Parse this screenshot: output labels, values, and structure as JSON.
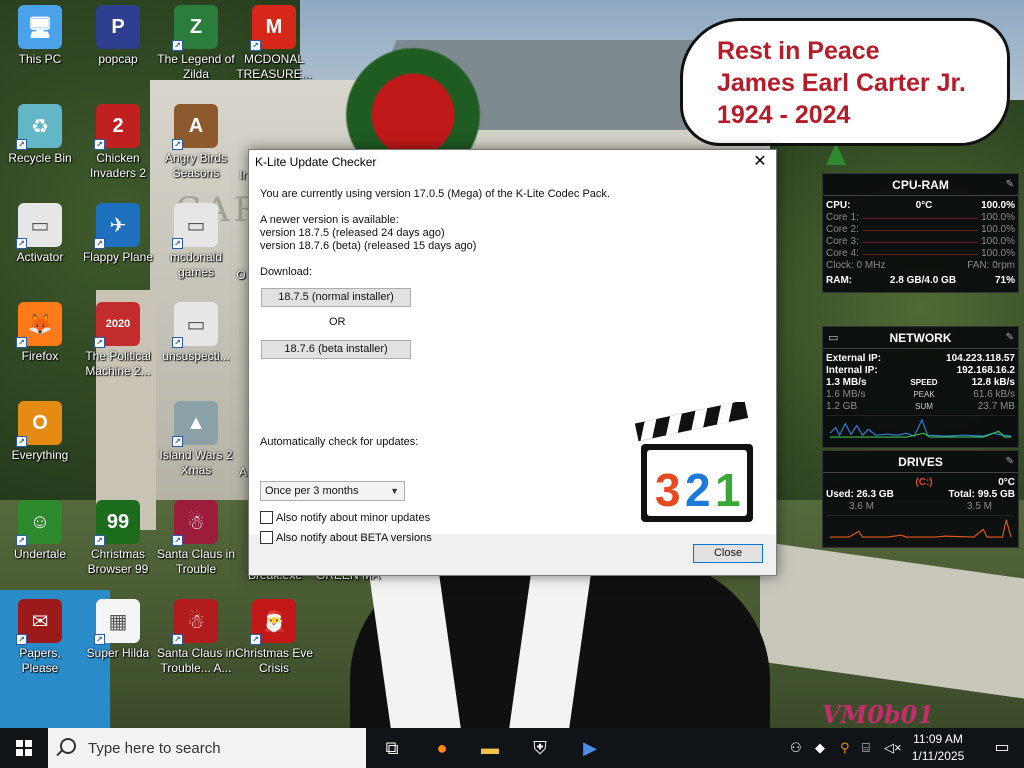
{
  "bubble": {
    "line1": "Rest in Peace",
    "line2": "James Earl Carter Jr.",
    "line3": "1924 - 2024"
  },
  "wallpaper": {
    "carved_text": "CAR",
    "watermark": "VM0b01"
  },
  "desktop_icons": [
    {
      "label": "This PC",
      "color": "#4aa3ea",
      "glyph": "🖥"
    },
    {
      "label": "popcap",
      "color": "#2e3f8f",
      "glyph": "P"
    },
    {
      "label": "The Legend of Zilda",
      "color": "#2a7d3a",
      "glyph": "Z"
    },
    {
      "label": "MCDONAL TREASURE...",
      "color": "#d62718",
      "glyph": "M"
    },
    {
      "label": "Recycle Bin",
      "color": "#63b6c5",
      "glyph": "♻"
    },
    {
      "label": "Chicken Invaders 2",
      "color": "#c02020",
      "glyph": "2"
    },
    {
      "label": "Angry Birds Seasons",
      "color": "#8c5a2c",
      "glyph": "A"
    },
    {
      "label": "Activator",
      "color": "#e6e6e6",
      "glyph": "▭"
    },
    {
      "label": "Flappy Plane",
      "color": "#1f6fbf",
      "glyph": "✈"
    },
    {
      "label": "mcdonald games",
      "color": "#e6e6e6",
      "glyph": "▭"
    },
    {
      "label": "Firefox",
      "color": "#ff7a18",
      "glyph": "🦊"
    },
    {
      "label": "The Political Machine 2...",
      "color": "#c22c2c",
      "glyph": "2020"
    },
    {
      "label": "unsuspecti...",
      "color": "#e6e6e6",
      "glyph": "▭"
    },
    {
      "label": "Everything",
      "color": "#e58a12",
      "glyph": "O"
    },
    {
      "label": "Island Wars 2 Xmas",
      "color": "#8aa1a8",
      "glyph": "▲"
    },
    {
      "label": "Undertale",
      "color": "#2d8a2d",
      "glyph": "☺"
    },
    {
      "label": "Christmas Browser 99",
      "color": "#1d6b1d",
      "glyph": "99"
    },
    {
      "label": "Santa Claus in Trouble",
      "color": "#9c1c3c",
      "glyph": "☃"
    },
    {
      "label": "Papers, Please",
      "color": "#9d1a1a",
      "glyph": "✉"
    },
    {
      "label": "Super Hilda",
      "color": "#f5f5f5",
      "glyph": "▦"
    },
    {
      "label": "Santa Claus in Trouble... A...",
      "color": "#b21c1c",
      "glyph": "☃"
    },
    {
      "label": "Christmas Eve Crisis",
      "color": "#c21818",
      "glyph": "🎅"
    }
  ],
  "partial_labels": {
    "break_exe": "Break.exe",
    "green_ma": "GREEN MA",
    "o_label": "O",
    "i_label": "Ir",
    "a_label": "A"
  },
  "dialog": {
    "title": "K-Lite Update Checker",
    "close_glyph": "✕",
    "current_version": "You are currently using version 17.0.5 (Mega) of the K-Lite Codec Pack.",
    "newer_available": "A newer version is available:",
    "version_normal": "version 18.7.5  (released 24 days ago)",
    "version_beta": "version 18.7.6  (beta)  (released 15 days ago)",
    "download_label": "Download:",
    "btn_normal": "18.7.5 (normal installer)",
    "or_text": "OR",
    "btn_beta": "18.7.6 (beta installer)",
    "auto_check_label": "Automatically check for updates:",
    "frequency": "Once per 3 months",
    "notify_minor": "Also notify about minor updates",
    "notify_beta": "Also notify about BETA versions",
    "notify_minor_checked": false,
    "notify_beta_checked": false,
    "close_button": "Close",
    "logo_digits": [
      "3",
      "2",
      "1"
    ],
    "logo_colors": [
      "#e8491e",
      "#1e7ad6",
      "#3aa836"
    ]
  },
  "cpu_gadget": {
    "title": "CPU-RAM",
    "cpu_label": "CPU:",
    "cpu_temp": "0°C",
    "cpu_pct": "100.0%",
    "cores": [
      {
        "label": "Core 1:",
        "value": "100.0%"
      },
      {
        "label": "Core 2:",
        "value": "100.0%"
      },
      {
        "label": "Core 3:",
        "value": "100.0%"
      },
      {
        "label": "Core 4:",
        "value": "100.0%"
      }
    ],
    "clock": "Clock: 0 MHz",
    "fan": "FAN: 0rpm",
    "ram_label": "RAM:",
    "ram_used": "2.8 GB/4.0 GB",
    "ram_pct": "71%"
  },
  "network_gadget": {
    "title": "NETWORK",
    "external_label": "External IP:",
    "external_ip": "104.223.118.57",
    "internal_label": "Internal IP:",
    "internal_ip": "192.168.16.2",
    "speed_down": "1.3 MB/s",
    "speed_label": "SPEED",
    "speed_up": "12.8 kB/s",
    "peak_down": "1.6 MB/s",
    "peak_label": "PEAK",
    "peak_up": "61.6 kB/s",
    "sum_down": "1.2 GB",
    "sum_label": "SUM",
    "sum_up": "23.7 MB"
  },
  "drives_gadget": {
    "title": "DRIVES",
    "drive": "(C:)",
    "temp": "0°C",
    "used": "Used: 26.3 GB",
    "total": "Total: 99.5 GB",
    "read": "3.6 M",
    "write": "3.5 M"
  },
  "taskbar": {
    "search_placeholder": "Type here to search",
    "time": "11:09 AM",
    "date": "1/11/2025"
  }
}
